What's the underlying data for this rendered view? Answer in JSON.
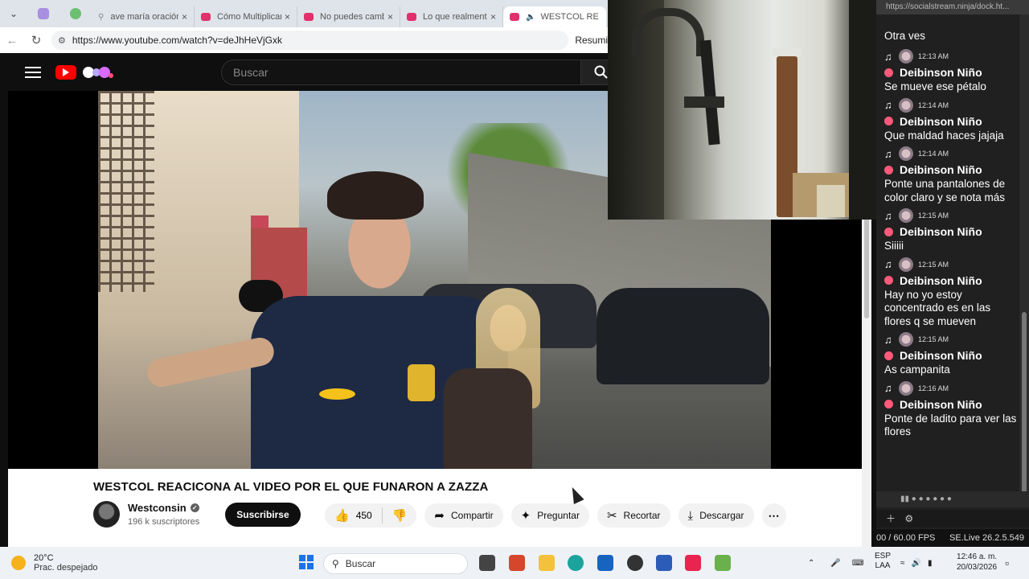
{
  "browser": {
    "tabs": [
      {
        "label": "ave maría oración"
      },
      {
        "label": "Cómo Multiplicar"
      },
      {
        "label": "No puedes cambi"
      },
      {
        "label": "Lo que realmente"
      },
      {
        "label": "WESTCOL RE"
      }
    ],
    "url": "https://www.youtube.com/watch?v=deJhHeVjGxk",
    "right_action": "Resumi"
  },
  "youtube": {
    "search_placeholder": "Buscar",
    "video_title": "WESTCOL REACICONA AL VIDEO POR EL QUE FUNARON A ZAZZA",
    "channel_name": "Westconsin",
    "subscribers": "196 k suscriptores",
    "subscribe_label": "Suscribirse",
    "likes": "450",
    "share_label": "Compartir",
    "ask_label": "Preguntar",
    "clip_label": "Recortar",
    "download_label": "Descargar"
  },
  "chat": {
    "url": "https://socialstream.ninja/dock.ht...",
    "first_line": "Otra ves",
    "messages": [
      {
        "time": "12:13 AM",
        "name": "Deibinson Niño",
        "text": "Se mueve ese pétalo"
      },
      {
        "time": "12:14 AM",
        "name": "Deibinson Niño",
        "text": "Que maldad haces jajaja"
      },
      {
        "time": "12:14 AM",
        "name": "Deibinson Niño",
        "text": "Ponte una pantalones de color claro y se nota más"
      },
      {
        "time": "12:15 AM",
        "name": "Deibinson Niño",
        "text": "Siiiii"
      },
      {
        "time": "12:15 AM",
        "name": "Deibinson Niño",
        "text": "Hay no yo estoy concentrado es en las flores q se mueven"
      },
      {
        "time": "12:15 AM",
        "name": "Deibinson Niño",
        "text": "As campanita"
      },
      {
        "time": "12:16 AM",
        "name": "Deibinson Niño",
        "text": "Ponte de ladito para ver las flores"
      }
    ],
    "fps": "00 / 60.00 FPS",
    "version": "SE.Live 26.2.5.549"
  },
  "taskbar": {
    "temperature": "20°C",
    "weather": "Prac. despejado",
    "search_label": "Buscar",
    "lang_1": "ESP",
    "lang_2": "LAA",
    "time": "12:46 a. m.",
    "date": "20/03/2026"
  }
}
